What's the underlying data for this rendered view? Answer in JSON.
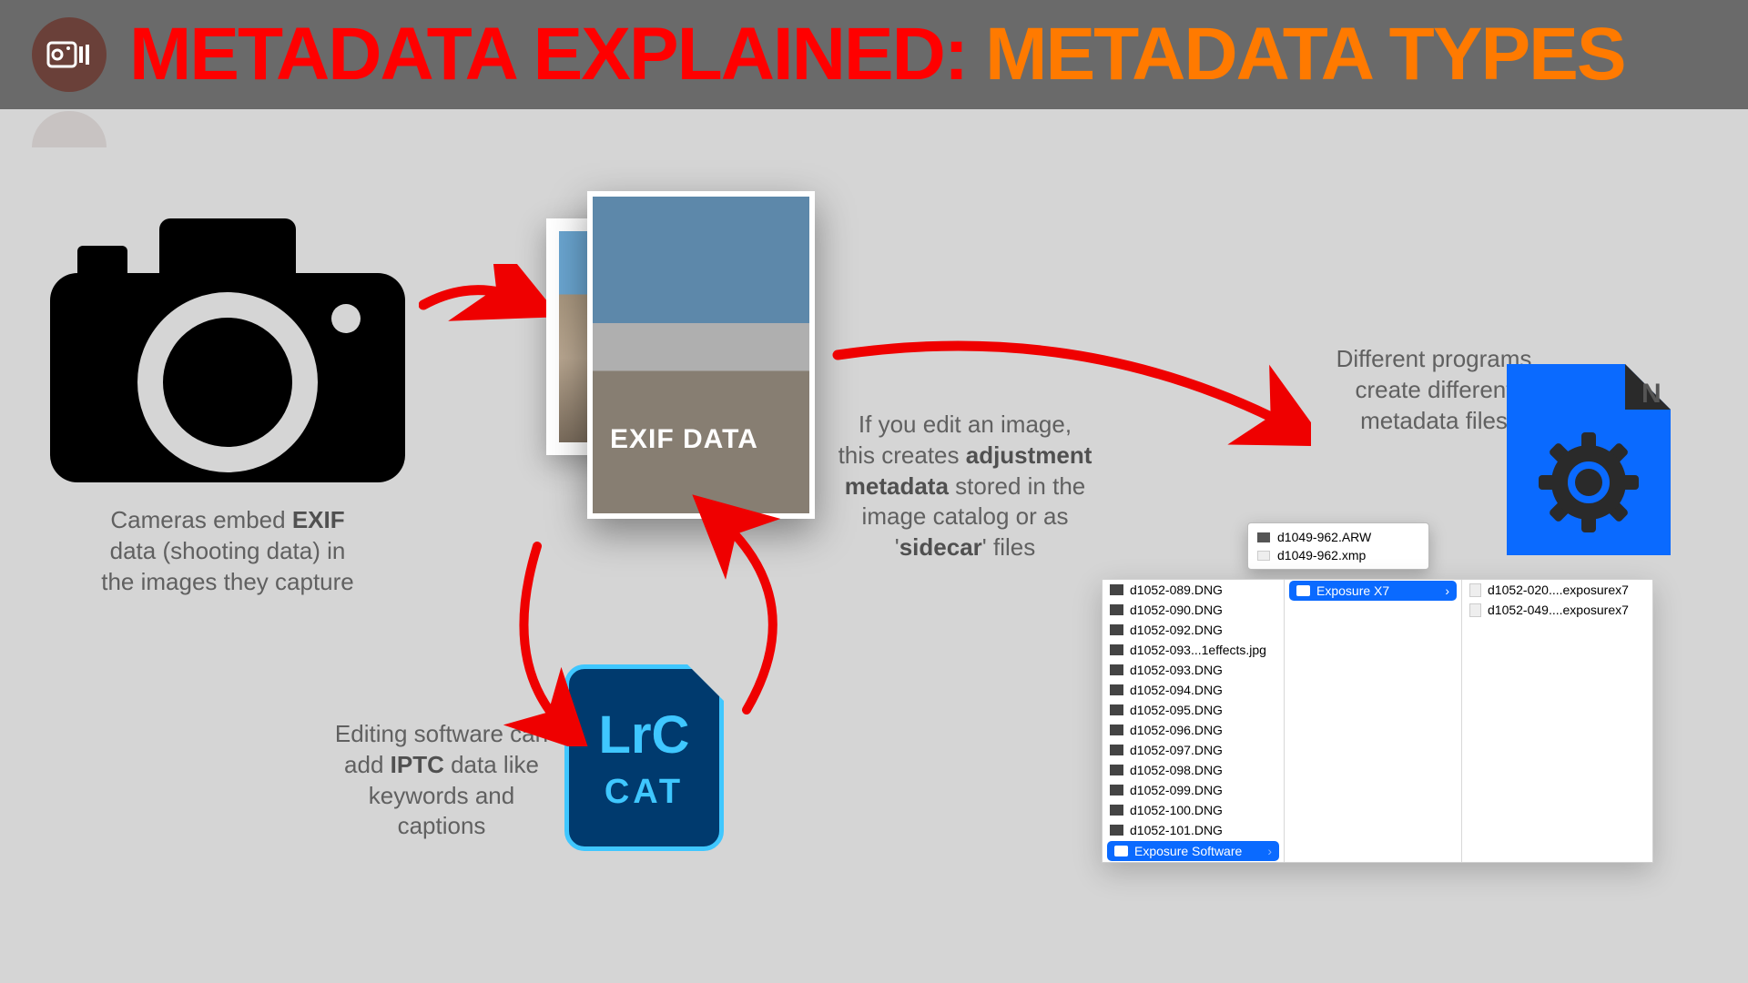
{
  "header": {
    "title_part1": "METADATA EXPLAINED:",
    "title_part2": "METADATA TYPES"
  },
  "photo": {
    "exif_label": "EXIF DATA"
  },
  "captions": {
    "camera_pre": "Cameras embed ",
    "camera_bold": "EXIF",
    "camera_post": " data (shooting data) in the images they capture",
    "iptc_pre": "Editing software can add ",
    "iptc_bold": "IPTC",
    "iptc_post": " data like keywords and captions",
    "adjust_pre": "If you edit an image, this creates ",
    "adjust_bold1": "adjustment metadata",
    "adjust_mid": " stored in the image catalog or as '",
    "adjust_bold2": "sidecar",
    "adjust_post": "' files",
    "programs": "Different programs create different metadata files"
  },
  "lrc": {
    "line1": "LrC",
    "line2": "CAT"
  },
  "popup": {
    "file1": "d1049-962.ARW",
    "file2": "d1049-962.xmp"
  },
  "finder": {
    "col1": [
      "d1052-089.DNG",
      "d1052-090.DNG",
      "d1052-092.DNG",
      "d1052-093...1effects.jpg",
      "d1052-093.DNG",
      "d1052-094.DNG",
      "d1052-095.DNG",
      "d1052-096.DNG",
      "d1052-097.DNG",
      "d1052-098.DNG",
      "d1052-099.DNG",
      "d1052-100.DNG",
      "d1052-101.DNG"
    ],
    "col1_folder": "Exposure Software",
    "col2_selected": "Exposure X7",
    "col3": [
      "d1052-020....exposurex7",
      "d1052-049....exposurex7"
    ]
  }
}
